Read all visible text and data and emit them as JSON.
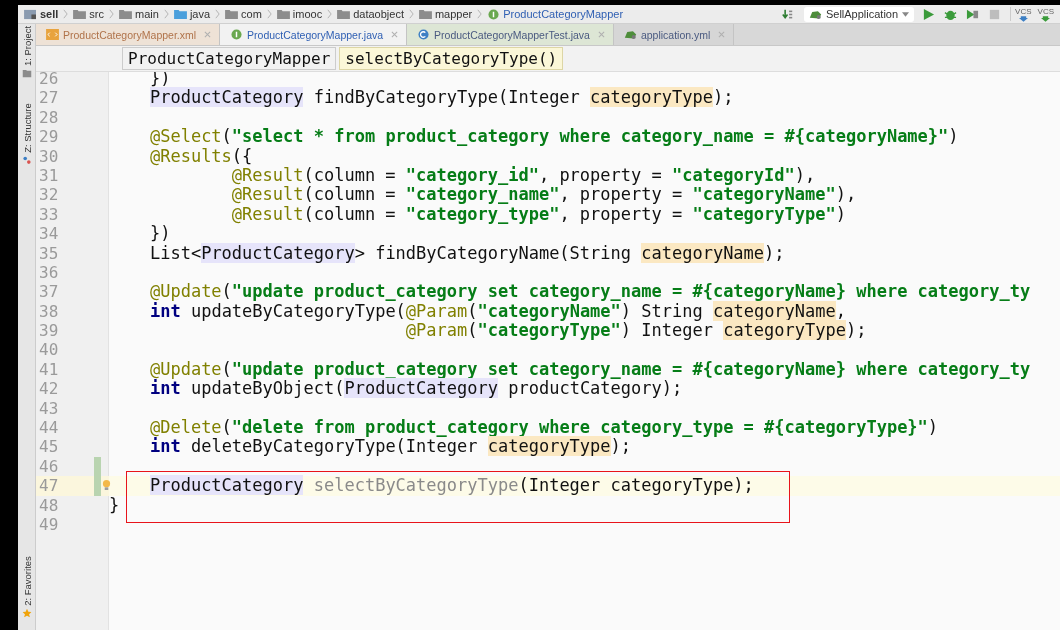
{
  "nav_bar": {
    "crumbs": [
      {
        "label": "sell",
        "kind": "module"
      },
      {
        "label": "src",
        "kind": "folder"
      },
      {
        "label": "main",
        "kind": "folder"
      },
      {
        "label": "java",
        "kind": "source"
      },
      {
        "label": "com",
        "kind": "package"
      },
      {
        "label": "imooc",
        "kind": "package"
      },
      {
        "label": "dataobject",
        "kind": "package"
      },
      {
        "label": "mapper",
        "kind": "package"
      },
      {
        "label": "ProductCategoryMapper",
        "kind": "interface"
      }
    ],
    "run_config": "SellApplication",
    "vcs_buttons": [
      "VCS",
      "VCS"
    ]
  },
  "tabs": [
    {
      "label": "ProductCategoryMapper.xml",
      "kind": "xml",
      "selected": false
    },
    {
      "label": "ProductCategoryMapper.java",
      "kind": "interface",
      "selected": true
    },
    {
      "label": "ProductCategoryMapperTest.java",
      "kind": "class",
      "selected": false
    },
    {
      "label": "application.yml",
      "kind": "spring",
      "selected": false
    }
  ],
  "tool_windows": [
    {
      "label": "1: Project",
      "kind": "project"
    },
    {
      "label": "Z: Structure",
      "kind": "structure"
    },
    {
      "label": "2: Favorites",
      "kind": "favorites"
    }
  ],
  "editor_breadcrumb": [
    {
      "label": "ProductCategoryMapper",
      "selected": false
    },
    {
      "label": "selectByCategoryType()",
      "selected": true
    }
  ],
  "lines": [
    {
      "kind": "line",
      "n": "26",
      "current": false,
      "changed": false,
      "tokens": [
        {
          "kind": "plain",
          "text": "    })"
        }
      ]
    },
    {
      "kind": "line",
      "n": "27",
      "current": false,
      "changed": false,
      "tokens": [
        {
          "kind": "type",
          "text": "    ProductCategory"
        },
        {
          "kind": "plain",
          "text": " findByCategoryType(Integer "
        },
        {
          "kind": "param",
          "text": "categoryType"
        },
        {
          "kind": "plain",
          "text": ");"
        }
      ]
    },
    {
      "kind": "line",
      "n": "28",
      "current": false,
      "changed": false
    },
    {
      "kind": "line",
      "n": "29",
      "current": false,
      "changed": false,
      "tokens": [
        {
          "kind": "annotation",
          "text": "    @Select"
        },
        {
          "kind": "plain",
          "text": "("
        },
        {
          "kind": "string",
          "text": "\"select * from product_category where category_name = #{categoryName}\""
        },
        {
          "kind": "plain",
          "text": ")"
        }
      ]
    },
    {
      "kind": "line",
      "n": "30",
      "current": false,
      "changed": false,
      "tokens": [
        {
          "kind": "annotation",
          "text": "    @Results"
        },
        {
          "kind": "plain",
          "text": "({"
        }
      ]
    },
    {
      "kind": "line",
      "n": "31",
      "current": false,
      "changed": false,
      "tokens": [
        {
          "kind": "annotation",
          "text": "            @Result"
        },
        {
          "kind": "plain",
          "text": "(column = "
        },
        {
          "kind": "string",
          "text": "\"category_id\""
        },
        {
          "kind": "plain",
          "text": ", property = "
        },
        {
          "kind": "string",
          "text": "\"categoryId\""
        },
        {
          "kind": "plain",
          "text": "),"
        }
      ]
    },
    {
      "kind": "line",
      "n": "32",
      "current": false,
      "changed": false,
      "tokens": [
        {
          "kind": "annotation",
          "text": "            @Result"
        },
        {
          "kind": "plain",
          "text": "(column = "
        },
        {
          "kind": "string",
          "text": "\"category_name\""
        },
        {
          "kind": "plain",
          "text": ", property = "
        },
        {
          "kind": "string",
          "text": "\"categoryName\""
        },
        {
          "kind": "plain",
          "text": "),"
        }
      ]
    },
    {
      "kind": "line",
      "n": "33",
      "current": false,
      "changed": false,
      "tokens": [
        {
          "kind": "annotation",
          "text": "            @Result"
        },
        {
          "kind": "plain",
          "text": "(column = "
        },
        {
          "kind": "string",
          "text": "\"category_type\""
        },
        {
          "kind": "plain",
          "text": ", property = "
        },
        {
          "kind": "string",
          "text": "\"categoryType\""
        },
        {
          "kind": "plain",
          "text": ")"
        }
      ]
    },
    {
      "kind": "line",
      "n": "34",
      "current": false,
      "changed": false,
      "tokens": [
        {
          "kind": "plain",
          "text": "    })"
        }
      ]
    },
    {
      "kind": "line",
      "n": "35",
      "current": false,
      "changed": false,
      "tokens": [
        {
          "kind": "plain",
          "text": "    List<"
        },
        {
          "kind": "type",
          "text": "ProductCategory"
        },
        {
          "kind": "plain",
          "text": "> findByCategoryName(String "
        },
        {
          "kind": "param",
          "text": "categoryName"
        },
        {
          "kind": "plain",
          "text": ");"
        }
      ]
    },
    {
      "kind": "line",
      "n": "36",
      "current": false,
      "changed": false
    },
    {
      "kind": "line",
      "n": "37",
      "current": false,
      "changed": false,
      "tokens": [
        {
          "kind": "annotation",
          "text": "    @Update"
        },
        {
          "kind": "plain",
          "text": "("
        },
        {
          "kind": "string",
          "text": "\"update product_category set category_name = #{categoryName} where category_ty"
        }
      ]
    },
    {
      "kind": "line",
      "n": "38",
      "current": false,
      "changed": false,
      "tokens": [
        {
          "kind": "keyword",
          "text": "    int"
        },
        {
          "kind": "plain",
          "text": " updateByCategoryType("
        },
        {
          "kind": "annotation",
          "text": "@Param"
        },
        {
          "kind": "plain",
          "text": "("
        },
        {
          "kind": "string",
          "text": "\"categoryName\""
        },
        {
          "kind": "plain",
          "text": ") String "
        },
        {
          "kind": "param",
          "text": "categoryName"
        },
        {
          "kind": "plain",
          "text": ","
        }
      ]
    },
    {
      "kind": "line",
      "n": "39",
      "current": false,
      "changed": false,
      "tokens": [
        {
          "kind": "annotation",
          "text": "                             @Param"
        },
        {
          "kind": "plain",
          "text": "("
        },
        {
          "kind": "string",
          "text": "\"categoryType\""
        },
        {
          "kind": "plain",
          "text": ") Integer "
        },
        {
          "kind": "param",
          "text": "categoryType"
        },
        {
          "kind": "plain",
          "text": ");"
        }
      ]
    },
    {
      "kind": "line",
      "n": "40",
      "current": false,
      "changed": false
    },
    {
      "kind": "line",
      "n": "41",
      "current": false,
      "changed": false,
      "tokens": [
        {
          "kind": "annotation",
          "text": "    @Update"
        },
        {
          "kind": "plain",
          "text": "("
        },
        {
          "kind": "string",
          "text": "\"update product_category set category_name = #{categoryName} where category_ty"
        }
      ]
    },
    {
      "kind": "line",
      "n": "42",
      "current": false,
      "changed": false,
      "tokens": [
        {
          "kind": "keyword",
          "text": "    int"
        },
        {
          "kind": "plain",
          "text": " updateByObject("
        },
        {
          "kind": "type",
          "text": "ProductCategory"
        },
        {
          "kind": "plain",
          "text": " productCategory);"
        }
      ]
    },
    {
      "kind": "line",
      "n": "43",
      "current": false,
      "changed": false
    },
    {
      "kind": "line",
      "n": "44",
      "current": false,
      "changed": false,
      "tokens": [
        {
          "kind": "annotation",
          "text": "    @Delete"
        },
        {
          "kind": "plain",
          "text": "("
        },
        {
          "kind": "string",
          "text": "\"delete from product_category where category_type = #{categoryType}\""
        },
        {
          "kind": "plain",
          "text": ")"
        }
      ]
    },
    {
      "kind": "line",
      "n": "45",
      "current": false,
      "changed": false,
      "tokens": [
        {
          "kind": "keyword",
          "text": "    int"
        },
        {
          "kind": "plain",
          "text": " deleteByCategoryType(Integer "
        },
        {
          "kind": "param",
          "text": "categoryType"
        },
        {
          "kind": "plain",
          "text": ");"
        }
      ]
    },
    {
      "kind": "line",
      "n": "46",
      "current": false,
      "changed": true
    },
    {
      "kind": "frame",
      "children": [
        {
          "kind": "line",
          "n": "47",
          "current": true,
          "changed": true,
          "tokens": [
            {
              "kind": "type",
              "text": "    ProductCategory"
            },
            {
              "kind": "unused",
              "text": " selectByCategoryType"
            },
            {
              "kind": "plain",
              "text": "(Integer categoryType);"
            }
          ]
        },
        {
          "kind": "line",
          "n": "48",
          "current": false,
          "changed": false,
          "tokens": [
            {
              "kind": "plain",
              "text": "}"
            }
          ]
        }
      ]
    },
    {
      "kind": "line",
      "n": "49",
      "current": false,
      "changed": false
    }
  ]
}
